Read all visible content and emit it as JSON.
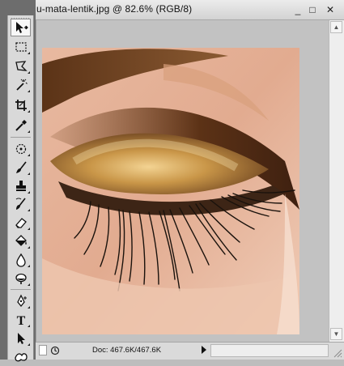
{
  "document": {
    "title": "u-mata-lentik.jpg @ 82.6% (RGB/8)",
    "minimize_glyph": "_",
    "restore_glyph": "□",
    "close_glyph": "✕"
  },
  "tools": [
    {
      "name": "move-tool",
      "icon": "move-icon",
      "active": true
    },
    {
      "name": "marquee-tool",
      "icon": "rect-marquee-icon"
    },
    {
      "name": "lasso-tool",
      "icon": "polygon-lasso-icon"
    },
    {
      "name": "magic-wand-tool",
      "icon": "magic-wand-icon"
    },
    {
      "name": "crop-tool",
      "icon": "crop-icon"
    },
    {
      "name": "eyedropper-tool",
      "icon": "eyedropper-icon"
    },
    {
      "name": "healing-brush-tool",
      "icon": "healing-brush-icon"
    },
    {
      "name": "brush-tool",
      "icon": "brush-icon"
    },
    {
      "name": "clone-stamp-tool",
      "icon": "clone-stamp-icon"
    },
    {
      "name": "history-brush-tool",
      "icon": "history-brush-icon"
    },
    {
      "name": "eraser-tool",
      "icon": "eraser-icon"
    },
    {
      "name": "paint-bucket-tool",
      "icon": "paint-bucket-icon"
    },
    {
      "name": "blur-tool",
      "icon": "blur-drop-icon"
    },
    {
      "name": "dodge-tool",
      "icon": "dodge-icon"
    },
    {
      "name": "pen-tool",
      "icon": "pen-icon"
    },
    {
      "name": "type-tool",
      "icon": "type-icon",
      "glyph": "T"
    },
    {
      "name": "path-selection-tool",
      "icon": "path-selection-icon"
    },
    {
      "name": "custom-shape-tool",
      "icon": "custom-shape-icon"
    }
  ],
  "status": {
    "doc_info": "Doc: 467.6K/467.6K"
  },
  "colors": {
    "canvas_bg": "#c2c2c2",
    "panel_dark": "#6d6d6d",
    "panel_light": "#d9d9d9"
  }
}
